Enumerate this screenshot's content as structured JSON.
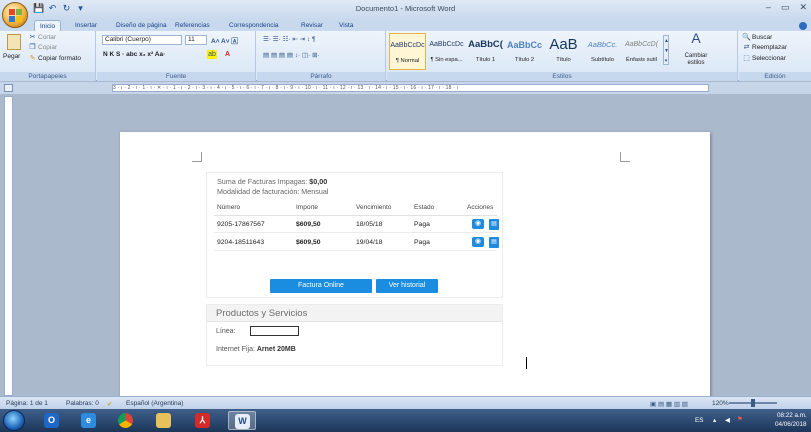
{
  "window": {
    "title": "Documento1 - Microsoft Word",
    "controls": [
      "–",
      "▭",
      "✕"
    ]
  },
  "qat": {
    "save": "💾",
    "undo": "↶",
    "redo": "↻",
    "more": "▾"
  },
  "tabs": [
    "Inicio",
    "Insertar",
    "Diseño de página",
    "Referencias",
    "Correspondencia",
    "Revisar",
    "Vista"
  ],
  "ribbon": {
    "clipboard": {
      "label": "Portapapeles",
      "paste": "Pegar",
      "cut": "Cortar",
      "copy": "Copiar",
      "format_painter": "Copiar formato"
    },
    "font": {
      "label": "Fuente",
      "font_name": "Calibri (Cuerpo)",
      "font_size": "11"
    },
    "paragraph": {
      "label": "Párrafo"
    },
    "styles": {
      "label": "Estilos",
      "items": [
        {
          "sample": "AaBbCcDc",
          "name": "¶ Normal"
        },
        {
          "sample": "AaBbCcDc",
          "name": "¶ Sin espa..."
        },
        {
          "sample": "AaBbC(",
          "name": "Título 1"
        },
        {
          "sample": "AaBbCc",
          "name": "Título 2"
        },
        {
          "sample": "AaB",
          "name": "Título"
        },
        {
          "sample": "AaBbCc.",
          "name": "Subtítulo"
        },
        {
          "sample": "AaBbCcD(",
          "name": "Énfasis sutil"
        }
      ],
      "change": "Cambiar estilos"
    },
    "editing": {
      "label": "Edición",
      "find": "Buscar",
      "replace": "Reemplazar",
      "select": "Seleccionar"
    }
  },
  "ruler": {
    "text": "3 · ı · 2 · ı · 1 · ı · ✕ · ı · 1 · ı · 2 · ı · 3 · ı · 4 · ı · 5 · ı · 6 · ı · 7 · ı · 8 · ı · 9 · ı · 10 · ı · 11 · ı · 12 · ı · 13 · ı · 14 · ı · 15 · ı · 16 · ı · 17 · ı · 18 · ı"
  },
  "document": {
    "summary_label": "Suma de Facturas Impagas:",
    "summary_value": "$0,00",
    "billing": "Modalidad de facturación: Mensual",
    "table": {
      "headers": [
        "Número",
        "Importe",
        "Vencimiento",
        "Estado",
        "Acciones"
      ],
      "rows": [
        {
          "numero": "9205-17867567",
          "importe": "$609,50",
          "vencimiento": "18/05/18",
          "estado": "Paga"
        },
        {
          "numero": "9204-18511643",
          "importe": "$609,50",
          "vencimiento": "19/04/18",
          "estado": "Paga"
        }
      ]
    },
    "buttons": {
      "factura": "Factura Online",
      "historial": "Ver historial"
    },
    "products": {
      "title": "Productos y Servicios",
      "linea_label": "Línea:",
      "internet_label": "Internet Fija:",
      "internet_value": "Arnet 20MB"
    }
  },
  "status": {
    "page": "Página: 1 de 1",
    "words": "Palabras: 0",
    "language": "Español (Argentina)",
    "zoom": "120%"
  },
  "tray": {
    "lang": "ES",
    "time": "08:22 a.m.",
    "date": "04/06/2018"
  }
}
